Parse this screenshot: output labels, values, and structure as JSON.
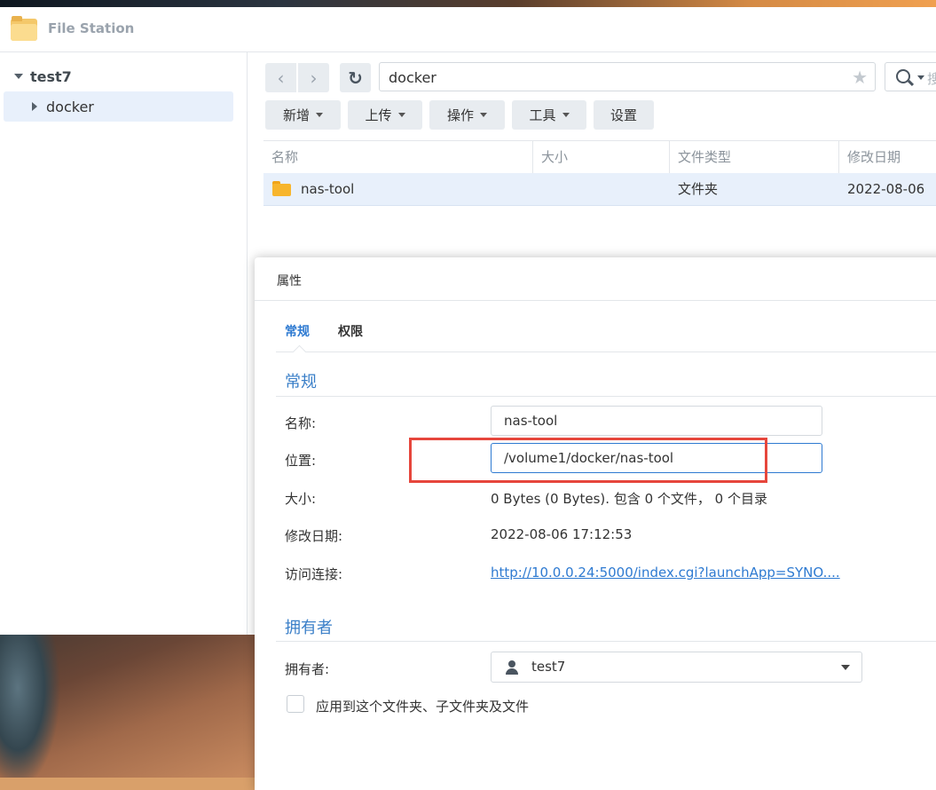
{
  "window": {
    "title": "File Station"
  },
  "sidebar": {
    "root": "test7",
    "items": [
      {
        "label": "docker"
      }
    ]
  },
  "toolbar": {
    "path": "docker",
    "search_placeholder": "搜",
    "buttons": [
      {
        "label": "新增"
      },
      {
        "label": "上传"
      },
      {
        "label": "操作"
      },
      {
        "label": "工具"
      },
      {
        "label": "设置"
      }
    ]
  },
  "file_list": {
    "columns": [
      "名称",
      "大小",
      "文件类型",
      "修改日期"
    ],
    "rows": [
      {
        "name": "nas-tool",
        "size": "",
        "type": "文件夹",
        "modified": "2022-08-06"
      }
    ]
  },
  "dialog": {
    "title": "属性",
    "tabs": [
      "常规",
      "权限"
    ],
    "general_section": "常规",
    "fields": {
      "name_label": "名称:",
      "name_value": "nas-tool",
      "location_label": "位置:",
      "location_value": "/volume1/docker/nas-tool",
      "size_label": "大小:",
      "size_value": "0 Bytes (0 Bytes). 包含 0 个文件， 0 个目录",
      "modified_label": "修改日期:",
      "modified_value": "2022-08-06 17:12:53",
      "link_label": "访问连接:",
      "link_value": "http://10.0.0.24:5000/index.cgi?launchApp=SYNO...."
    },
    "owner_section": "拥有者",
    "owner_label": "拥有者:",
    "owner_value": "test7",
    "apply_label": "应用到这个文件夹、子文件夹及文件"
  },
  "colors": {
    "accent": "#2e7ad1",
    "highlight": "#e6463c",
    "selected_row": "#e8f0fb"
  }
}
